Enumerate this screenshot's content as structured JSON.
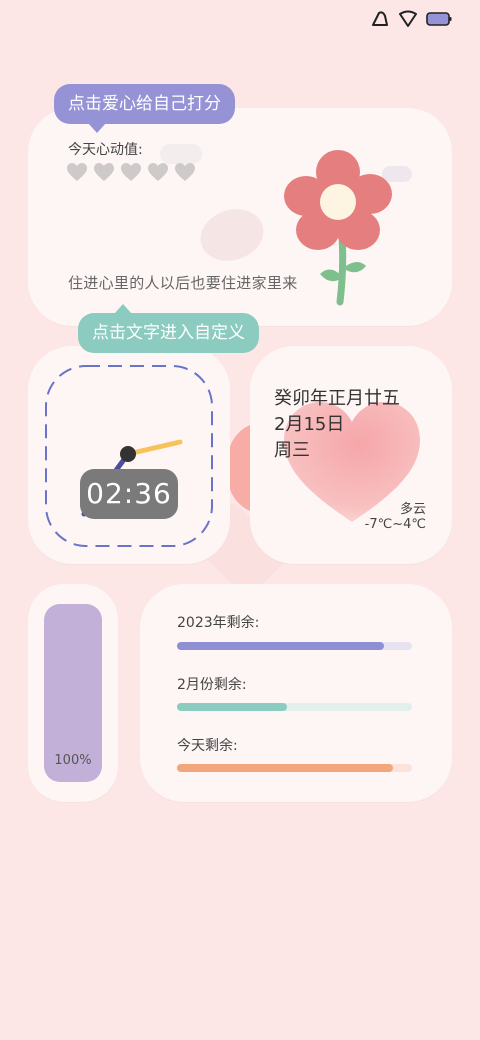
{
  "colors": {
    "background": "#fde6e6",
    "card": "#fdf6f5",
    "bubble_purple": "#9593d6",
    "bubble_teal": "#8ccbbf",
    "flower_petal": "#e57f7f",
    "flower_center": "#fdf5e2",
    "flower_stem": "#7fbf8e",
    "battery": "#c3b0d9"
  },
  "mood_widget": {
    "tooltip": "点击爱心给自己打分",
    "label": "今天心动值:",
    "hearts_total": 5,
    "hearts_filled": 0,
    "quote": "住进心里的人以后也要住进家里来"
  },
  "clock_widget": {
    "tooltip": "点击文字进入自定义",
    "time": "02:36"
  },
  "date_widget": {
    "lunar_date": "癸卯年正月廿五",
    "date": "2月15日",
    "weekday": "周三",
    "weather": "多云",
    "temperature": "-7℃~4℃"
  },
  "battery_widget": {
    "percent_label": "100%",
    "level": 1.0
  },
  "progress_widget": {
    "items": [
      {
        "label": "2023年剩余:",
        "fraction": 0.88,
        "color": "#8f8fd4",
        "track": "#e6e2f0"
      },
      {
        "label": "2月份剩余:",
        "fraction": 0.47,
        "color": "#8ccbbf",
        "track": "#e2efec"
      },
      {
        "label": "今天剩余:",
        "fraction": 0.92,
        "color": "#f3a679",
        "track": "#fbe3da"
      }
    ]
  }
}
